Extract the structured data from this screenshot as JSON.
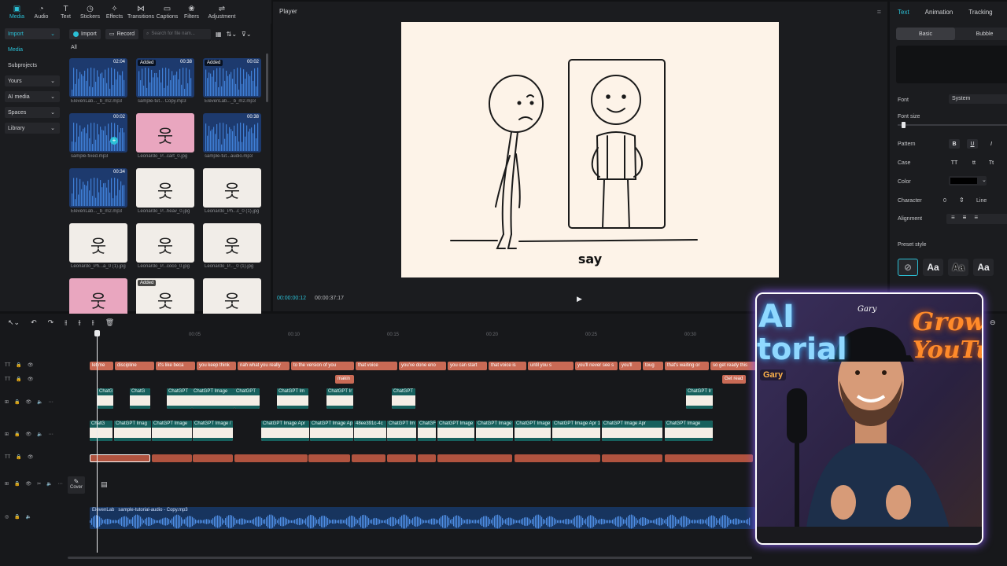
{
  "toolbar": {
    "tools": [
      {
        "label": "Media",
        "icon": "media-icon"
      },
      {
        "label": "Audio",
        "icon": "audio-icon"
      },
      {
        "label": "Text",
        "icon": "text-icon"
      },
      {
        "label": "Stickers",
        "icon": "stickers-icon"
      },
      {
        "label": "Effects",
        "icon": "effects-icon"
      },
      {
        "label": "Transitions",
        "icon": "transitions-icon"
      },
      {
        "label": "Captions",
        "icon": "captions-icon"
      },
      {
        "label": "Filters",
        "icon": "filters-icon"
      },
      {
        "label": "Adjustment",
        "icon": "adjustment-icon"
      }
    ]
  },
  "leftnav": {
    "import": "Import",
    "media": "Media",
    "subprojects": "Subprojects",
    "yours": "Yours",
    "ai_media": "AI media",
    "spaces": "Spaces",
    "library": "Library"
  },
  "media": {
    "import_btn": "Import",
    "record_btn": "Record",
    "search_placeholder": "Search for file nam...",
    "all": "All",
    "items": [
      {
        "caption": "ElevenLab..._b_m2.mp3",
        "type": "audio",
        "duration": "02:04",
        "added": ""
      },
      {
        "caption": "sample-tut... Copy.mp3",
        "type": "audio",
        "duration": "00:38",
        "added": "Added"
      },
      {
        "caption": "ElevenLab..._b_m2.mp3",
        "type": "audio",
        "duration": "00:02",
        "added": "Added"
      },
      {
        "caption": "sample-fixed.mp3",
        "type": "audio",
        "duration": "00:02",
        "added": ""
      },
      {
        "caption": "Leonardo_P...cart_0.jpg",
        "type": "pink",
        "duration": "",
        "added": ""
      },
      {
        "caption": "sample-tut...audio.mp3",
        "type": "audio",
        "duration": "00:38",
        "added": ""
      },
      {
        "caption": "ElevenLab..._b_m2.mp3",
        "type": "audio",
        "duration": "00:34",
        "added": ""
      },
      {
        "caption": "Leonardo_P...heav_0.jpg",
        "type": "img",
        "duration": "",
        "added": ""
      },
      {
        "caption": "Leonardo_Ph...c_0 (1).jpg",
        "type": "img",
        "duration": "",
        "added": ""
      },
      {
        "caption": "Leonardo_Ph...a_0 (1).jpg",
        "type": "img",
        "duration": "",
        "added": ""
      },
      {
        "caption": "Leonardo_P...coco_0.jpg",
        "type": "img",
        "duration": "",
        "added": ""
      },
      {
        "caption": "Leonardo_P..._0 (1).jpg",
        "type": "img",
        "duration": "",
        "added": ""
      },
      {
        "caption": "",
        "type": "pink",
        "duration": "",
        "added": ""
      },
      {
        "caption": "",
        "type": "img",
        "duration": "",
        "added": "Added"
      },
      {
        "caption": "",
        "type": "img",
        "duration": "",
        "added": ""
      }
    ]
  },
  "player": {
    "title": "Player",
    "caption": "say",
    "time_current": "00:00:00:12",
    "time_total": "00:00:37:17"
  },
  "inspector": {
    "tabs": [
      "Text",
      "Animation",
      "Tracking",
      "Te"
    ],
    "seg_basic": "Basic",
    "seg_bubble": "Bubble",
    "font_label": "Font",
    "font_value": "System",
    "font_size_label": "Font size",
    "pattern_label": "Pattern",
    "case_label": "Case",
    "case_options": [
      "TT",
      "tt",
      "Tt"
    ],
    "color_label": "Color",
    "color_value": "#000000",
    "character_label": "Character",
    "character_value": "0",
    "line_label": "Line",
    "alignment_label": "Alignment",
    "preset_label": "Preset style",
    "preset_sample": "Aa"
  },
  "timeline": {
    "ruler": [
      "00:05",
      "00:10",
      "00:15",
      "00:20",
      "00:25",
      "00:30",
      "00:35"
    ],
    "text_clips": [
      "let me",
      "discipline",
      "it's like beca",
      "you keep think",
      "nah what you really",
      "to the version of you",
      "that voice",
      "you've done eno",
      "you can start",
      "that voice is",
      "until you s",
      "you'll never see s",
      "you'll",
      "toug",
      "that's waiting or",
      "so get ready this"
    ],
    "text_clips_row2": [
      "makin",
      "Get read"
    ],
    "video_row1": [
      "ChatG",
      "ChatG",
      "ChatGPT",
      "ChatGPT Image",
      "ChatGPT",
      "ChatGPT Im",
      "ChatGPT Ir",
      "ChatGPT",
      "ChatGPT Ir"
    ],
    "video_row2": [
      "ChatG",
      "ChatGPT Imag",
      "ChatGPT Image",
      "ChatGPT Image /",
      "ChatGPT Image Apr",
      "ChatGPT Image Ap",
      "48ee391c-4c",
      "ChatGPT Im",
      "ChatGF",
      "ChatGPT Image",
      "ChatGPT Image",
      "ChatGPT Image Apr 1",
      "ChatGPT Image Apr 17, 20",
      "ChatGPT Image Apr",
      "ChatGPT Image"
    ],
    "cover_label": "Cover",
    "audio_label_1": "ElevenLab",
    "audio_label_2": "sample-tutorial-audio - Copy.mp3"
  },
  "webcam": {
    "hat_text": "Gary",
    "neon_left_1": "AI",
    "neon_left_2": "torial",
    "neon_right_1": "Grow o",
    "neon_right_2": "YouTu",
    "badge": "Gary"
  }
}
